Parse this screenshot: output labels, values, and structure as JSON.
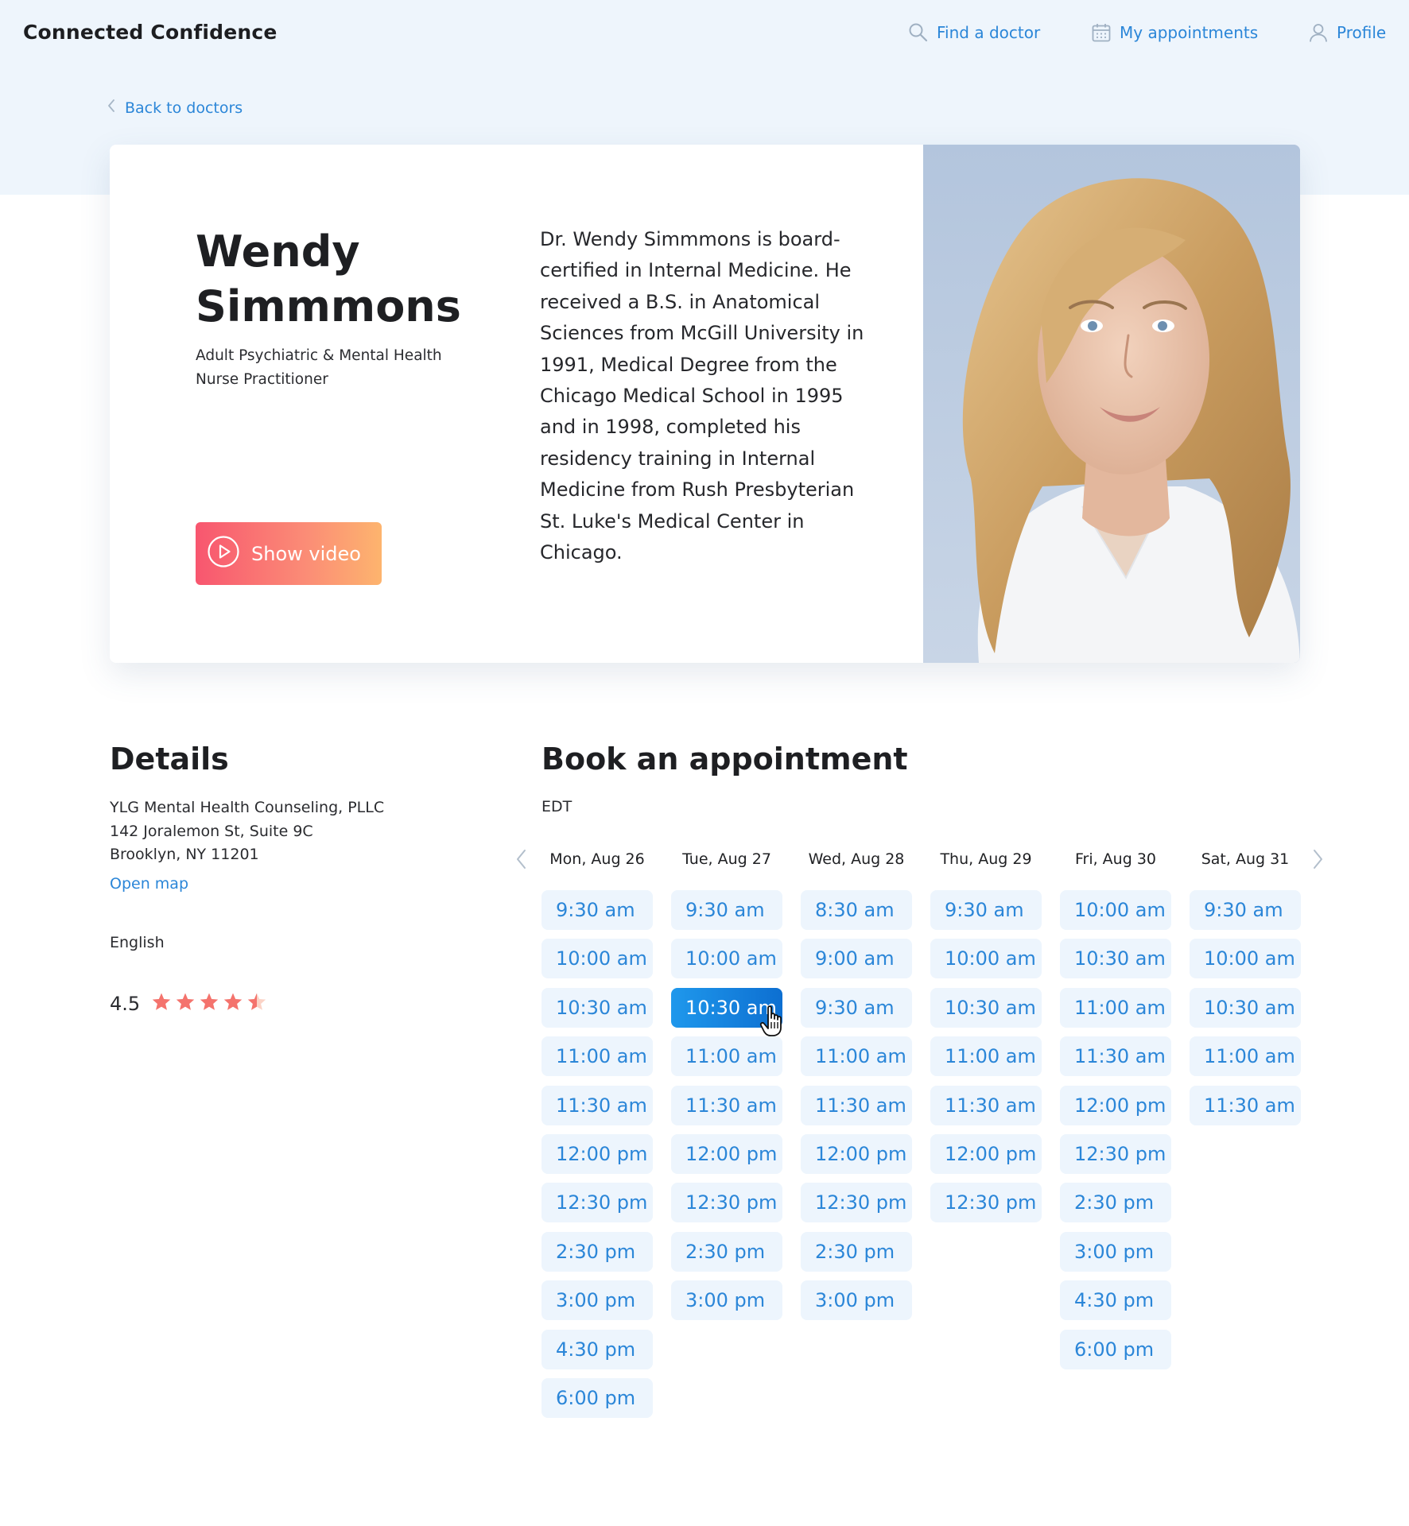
{
  "header": {
    "brand": "Connected Confidence",
    "nav": [
      {
        "label": "Find a doctor",
        "icon": "search-icon"
      },
      {
        "label": "My appointments",
        "icon": "calendar-icon"
      },
      {
        "label": "Profile",
        "icon": "user-icon"
      }
    ]
  },
  "back_link": "Back to doctors",
  "doctor": {
    "name": "Wendy Simmmons",
    "title": "Adult Psychiatric & Mental Health Nurse Practitioner",
    "video_button": "Show video",
    "bio": "Dr. Wendy Simmmons is board-certified in Internal Medicine. He received a B.S. in Anatomical Sciences from McGill University in 1991, Medical Degree from the Chicago Medical School in 1995 and in 1998, completed his residency training in Internal Medicine from Rush Presbyterian St. Luke's Medical Center in Chicago."
  },
  "details": {
    "heading": "Details",
    "practice": "YLG Mental Health Counseling, PLLC",
    "street": "142 Joralemon St, Suite 9C",
    "city": "Brooklyn, NY 11201",
    "map_link": "Open map",
    "language": "English",
    "rating": "4.5",
    "rating_value": 4.5,
    "rating_max": 5
  },
  "booking": {
    "heading": "Book an appointment",
    "timezone": "EDT",
    "selected": {
      "day": 1,
      "slot": 2
    },
    "days": [
      {
        "label": "Mon, Aug 26",
        "slots": [
          "9:30 am",
          "10:00 am",
          "10:30 am",
          "11:00 am",
          "11:30 am",
          "12:00 pm",
          "12:30 pm",
          "2:30 pm",
          "3:00 pm",
          "4:30 pm",
          "6:00 pm"
        ]
      },
      {
        "label": "Tue, Aug 27",
        "slots": [
          "9:30 am",
          "10:00 am",
          "10:30 am",
          "11:00 am",
          "11:30 am",
          "12:00 pm",
          "12:30 pm",
          "2:30 pm",
          "3:00 pm"
        ]
      },
      {
        "label": "Wed, Aug 28",
        "slots": [
          "8:30 am",
          "9:00 am",
          "9:30 am",
          "11:00 am",
          "11:30 am",
          "12:00 pm",
          "12:30 pm",
          "2:30 pm",
          "3:00 pm"
        ]
      },
      {
        "label": "Thu, Aug 29",
        "slots": [
          "9:30 am",
          "10:00 am",
          "10:30 am",
          "11:00 am",
          "11:30 am",
          "12:00 pm",
          "12:30 pm"
        ]
      },
      {
        "label": "Fri, Aug 30",
        "slots": [
          "10:00 am",
          "10:30 am",
          "11:00 am",
          "11:30 am",
          "12:00 pm",
          "12:30 pm",
          "2:30 pm",
          "3:00 pm",
          "4:30 pm",
          "6:00 pm"
        ]
      },
      {
        "label": "Sat, Aug 31",
        "slots": [
          "9:30 am",
          "10:00 am",
          "10:30 am",
          "11:00 am",
          "11:30 am"
        ]
      }
    ]
  },
  "colors": {
    "accent": "#2b86d8",
    "header_band": "#eef5fc",
    "slot_background": "#edf5fd",
    "selected_slot": "#1a8ae6",
    "star": "#f4736d",
    "video_gradient_start": "#f8566f",
    "video_gradient_end": "#fdb46e"
  }
}
